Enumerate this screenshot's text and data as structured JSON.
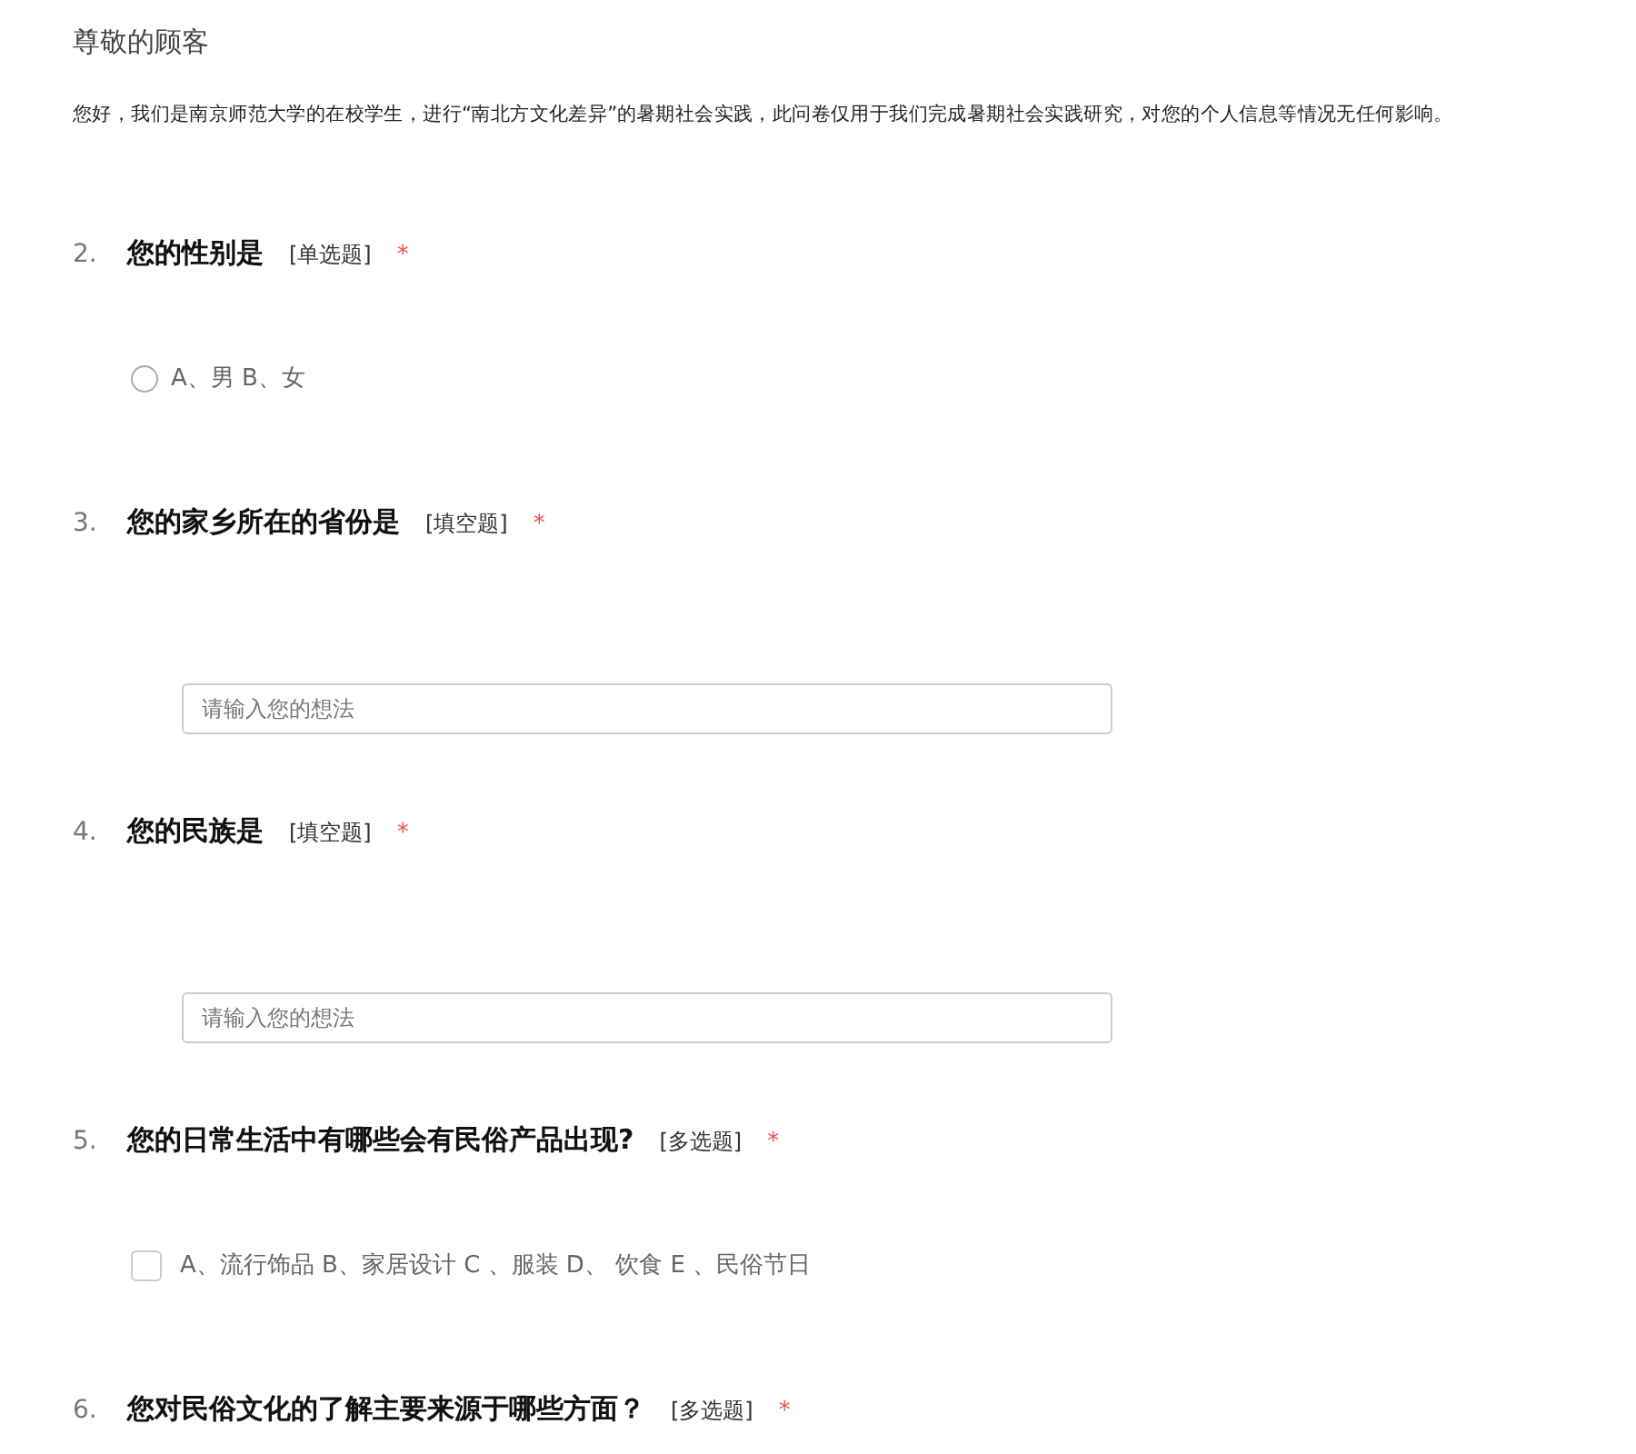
{
  "heading": "尊敬的顾客",
  "intro": "您好，我们是南京师范大学的在校学生，进行“南北方文化差异”的暑期社会实践，此问卷仅用于我们完成暑期社会实践研究，对您的个人信息等情况无任何影响。",
  "questions": [
    {
      "number": "2.",
      "title": "您的性别是",
      "type_tag": "[单选题]",
      "required_mark": "*",
      "kind": "radio",
      "option": "A、男 B、女",
      "checked": false
    },
    {
      "number": "3.",
      "title": "您的家乡所在的省份是",
      "type_tag": "[填空题]",
      "required_mark": "*",
      "kind": "text",
      "placeholder": "请输入您的想法"
    },
    {
      "number": "4.",
      "title": "您的民族是",
      "type_tag": "[填空题]",
      "required_mark": "*",
      "kind": "text",
      "placeholder": "请输入您的想法"
    },
    {
      "number": "5.",
      "title": "您的日常生活中有哪些会有民俗产品出现?",
      "type_tag": "[多选题]",
      "required_mark": "*",
      "kind": "checkbox",
      "option": "A、流行饰品 B、家居设计 C 、服装 D、 饮食 E 、民俗节日",
      "checked": false
    },
    {
      "number": "6.",
      "title": "您对民俗文化的了解主要来源于哪些方面？",
      "type_tag": "[多选题]",
      "required_mark": "*",
      "kind": "none"
    }
  ]
}
